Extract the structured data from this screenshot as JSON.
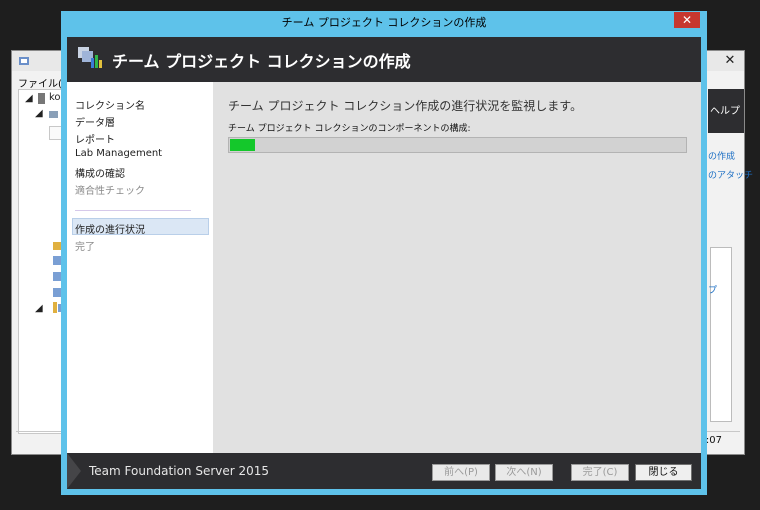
{
  "background_window": {
    "menu_file": "ファイル(F)",
    "tree": {
      "node_1": "ko"
    },
    "help_label": "ヘルプ",
    "links": [
      "の作成",
      "のアタッチ",
      "プ"
    ],
    "status_text": ":07",
    "close_glyph": "✕"
  },
  "dialog": {
    "window_title": "チーム プロジェクト コレクションの作成",
    "close_glyph": "✕",
    "header_title": "チーム プロジェクト コレクションの作成",
    "nav": {
      "items": [
        {
          "label": "コレクション名",
          "state": "normal"
        },
        {
          "label": "データ層",
          "state": "normal"
        },
        {
          "label": "レポート",
          "state": "normal"
        },
        {
          "label": "Lab Management",
          "state": "normal"
        },
        {
          "label": "構成の確認",
          "state": "normal"
        },
        {
          "label": "適合性チェック",
          "state": "dim"
        }
      ],
      "progress_items": [
        {
          "label": "作成の進行状況",
          "state": "selected"
        },
        {
          "label": "完了",
          "state": "dim"
        }
      ]
    },
    "content": {
      "heading": "チーム プロジェクト コレクション作成の進行状況を監視します。",
      "subheading": "チーム プロジェクト コレクションのコンポーネントの構成:",
      "progress_percent": 5.5
    },
    "footer": {
      "product": "Team Foundation Server 2015",
      "buttons": {
        "prev": "前へ(P)",
        "next": "次へ(N)",
        "finish": "完了(C)",
        "close": "閉じる"
      }
    }
  },
  "colors": {
    "dialog_border": "#5ec2ea",
    "header_bg": "#2d2d30",
    "progress_fill": "#14c82b",
    "close_button": "#c7372f"
  }
}
